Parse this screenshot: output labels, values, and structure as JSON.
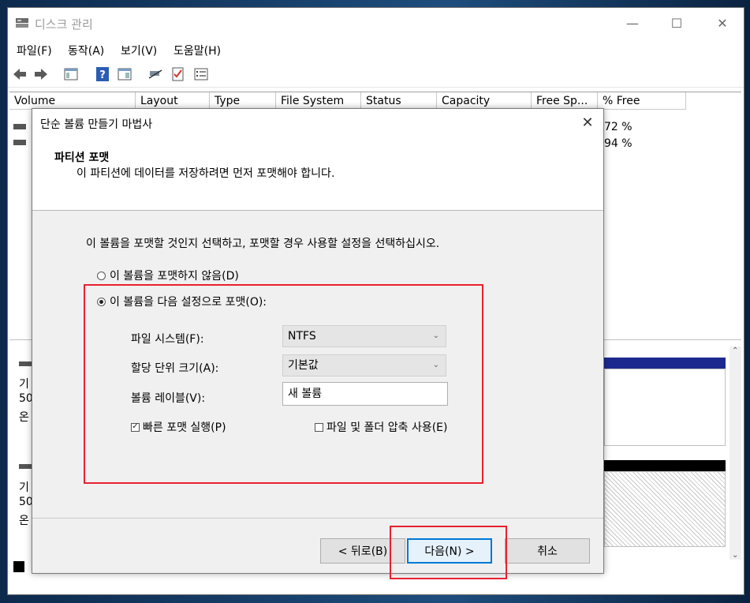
{
  "window": {
    "title": "디스크 관리"
  },
  "menu": [
    "파일(F)",
    "동작(A)",
    "보기(V)",
    "도움말(H)"
  ],
  "columns": [
    "Volume",
    "Layout",
    "Type",
    "File System",
    "Status",
    "Capacity",
    "Free Sp...",
    "% Free"
  ],
  "volume_rows": [
    {
      "pct_free": "72 %"
    },
    {
      "pct_free": "94 %"
    }
  ],
  "disks": [
    {
      "label1": "기",
      "label2": "50.",
      "label3": "온"
    },
    {
      "label1": "기",
      "label2": "50.",
      "label3": "온"
    }
  ],
  "dialog": {
    "title": "단순 볼륨 만들기 마법사",
    "heading": "파티션 포맷",
    "subheading": "이 파티션에 데이터를 저장하려면 먼저 포맷해야 합니다.",
    "instruction": "이 볼륨을 포맷할 것인지 선택하고, 포맷할 경우 사용할 설정을 선택하십시오.",
    "radio_no_format": "이 볼륨을 포맷하지 않음(D)",
    "radio_format": "이 볼륨을 다음 설정으로 포맷(O):",
    "fs_label": "파일 시스템(F):",
    "fs_value": "NTFS",
    "alloc_label": "할당 단위 크기(A):",
    "alloc_value": "기본값",
    "vol_label": "볼륨 레이블(V):",
    "vol_value": "새 볼륨",
    "quick_format": "빠른 포맷 실행(P)",
    "compress": "파일 및 폴더 압축 사용(E)",
    "back_button": "< 뒤로(B)",
    "next_button": "다음(N) >",
    "cancel_button": "취소"
  },
  "colors": {
    "highlight_red": "#e8212f",
    "focus_blue": "#0078d7"
  }
}
